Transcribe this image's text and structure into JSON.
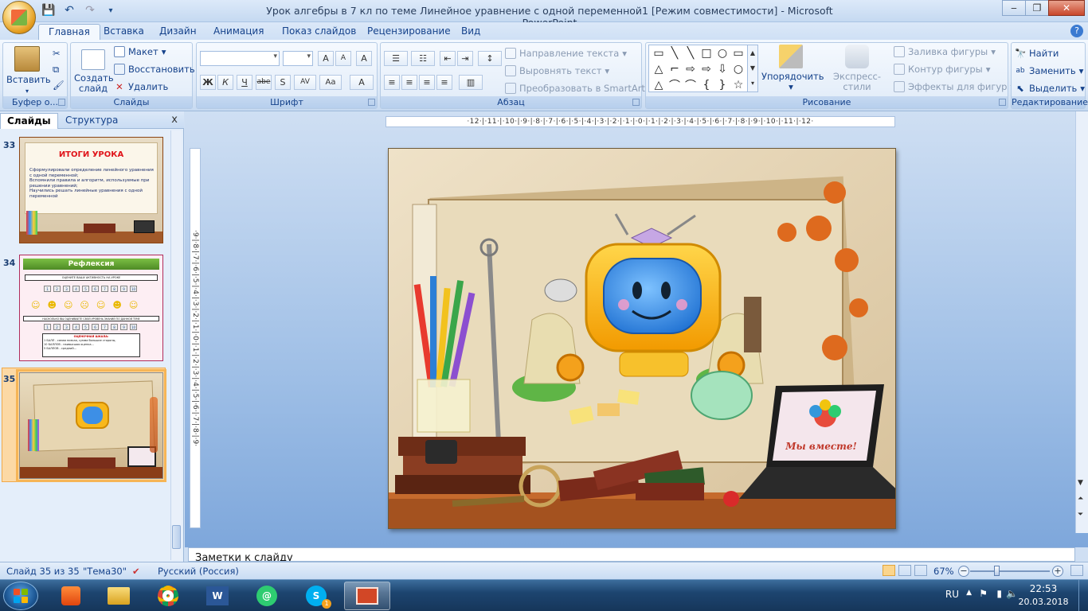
{
  "window": {
    "title": "Урок алгебры в 7 кл по теме  Линейное уравнение с одной переменной1 [Режим совместимости] - Microsoft PowerPoint",
    "controls": {
      "minimize": "‒",
      "maximize": "❐",
      "close": "✕"
    }
  },
  "qat": {
    "save": "💾",
    "undo": "↶",
    "redo": "↷",
    "more": "▾"
  },
  "tabs": [
    "Главная",
    "Вставка",
    "Дизайн",
    "Анимация",
    "Показ слайдов",
    "Рецензирование",
    "Вид"
  ],
  "help": "?",
  "ribbon": {
    "clipboard": {
      "paste": "Вставить",
      "label": "Буфер о..."
    },
    "slides": {
      "new_slide": "Создать слайд",
      "layout": "Макет",
      "reset": "Восстановить",
      "delete": "Удалить",
      "label": "Слайды"
    },
    "font": {
      "label": "Шрифт",
      "grow": "A",
      "shrink": "A",
      "clear": "A",
      "buttons": [
        "Ж",
        "К",
        "Ч",
        "abe",
        "S",
        "AV",
        "Aa",
        "A"
      ]
    },
    "paragraph": {
      "direction": "Направление текста",
      "align": "Выровнять текст",
      "smartart": "Преобразовать в SmartArt",
      "label": "Абзац"
    },
    "drawing": {
      "shapes": [
        "▭",
        "╲",
        "╲",
        "□",
        "○",
        "▭",
        "△",
        "⌐",
        "⇨",
        "⇨",
        "⇩",
        "○",
        "△",
        "⌒",
        "⌒",
        "{",
        "}",
        "☆"
      ],
      "arrange": "Упорядочить",
      "quick_styles": "Экспресс-стили",
      "fill": "Заливка фигуры",
      "outline": "Контур фигуры",
      "effects": "Эффекты для фигур",
      "label": "Рисование"
    },
    "editing": {
      "find": "Найти",
      "replace": "Заменить",
      "select": "Выделить",
      "label": "Редактирование"
    }
  },
  "left_pane": {
    "tabs": [
      "Слайды",
      "Структура"
    ],
    "close": "x",
    "slides": [
      {
        "number": "33",
        "title": "ИТОГИ УРОКА",
        "items": [
          "Сформулировали определение линейного уравнения с одной переменной;",
          "Вспомнили правила и алгоритм, используемые при решении уравнений;",
          "Научились решать  линейные уравнения с одной переменной"
        ]
      },
      {
        "number": "34",
        "title": "Рефлексия",
        "row1_title": "ОЦЕНИТЕ ВАШУ АКТИВНОСТЬ  НА УРОКЕ",
        "row2_title": "НАСКОЛЬКО ВЫ ОЦЕНИВАЕТЕ СВОЙ УРОВЕНЬ ЗНАНИЙ ПО ДАННОЙ ТЕМЕ",
        "scale": [
          "1",
          "2",
          "3",
          "4",
          "5",
          "6",
          "7",
          "8",
          "9",
          "10"
        ],
        "legend_title": "ОЦЕНОЧНАЯ ШКАЛА:",
        "legend_lines": [
          "1 БАЛЛ - самая низкая, сумма большие стороны,",
          "10 БАЛЛОВ - наивысшая оценка...",
          "5 БАЛЛОВ - средний..."
        ]
      },
      {
        "number": "35",
        "selected": true
      }
    ]
  },
  "rulers": {
    "horizontal": "·12·|·11·|·10·|·9·|·8·|·7·|·6·|·5·|·4·|·3·|·2·|·1·|·0·|·1·|·2·|·3·|·4·|·5·|·6·|·7·|·8·|·9·|·10·|·11·|·12·",
    "vertical": "·9·|·8·|·7·|·6·|·5·|·4·|·3·|·2·|·1·|·0·|·1·|·2·|·3·|·4·|·5·|·6·|·7·|·8·|·9·"
  },
  "slide": {
    "laptop_caption": "Мы вместе!"
  },
  "notes": {
    "placeholder": "Заметки к слайду"
  },
  "status": {
    "slide_info": "Слайд 35 из 35",
    "theme": "\"Тема30\"",
    "language": "Русский (Россия)",
    "zoom": "67%",
    "zoom_minus": "−",
    "zoom_plus": "+"
  },
  "taskbar": {
    "language": "RU",
    "time": "22:53",
    "date": "20.03.2018",
    "skype_badge": "1"
  },
  "colors": {
    "accent": "#15428b",
    "ribbon_bg": "#dce8f7",
    "selection": "#f6b556",
    "taskbar": "#1d4570"
  }
}
